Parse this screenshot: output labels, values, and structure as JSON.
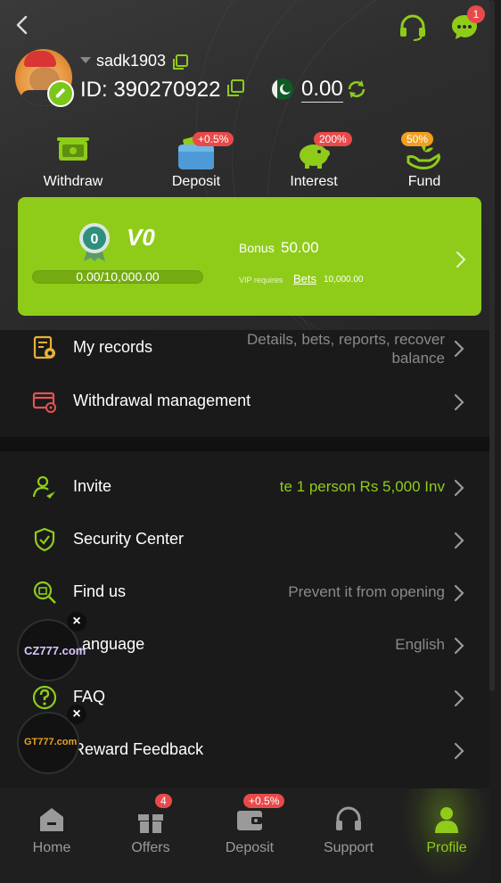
{
  "top_bar": {
    "back_icon": "chevron-left-icon",
    "support_icon": "headset-icon",
    "chat_icon": "chat-bubble-icon",
    "chat_badge": "1"
  },
  "profile": {
    "username": "sadk1903",
    "id_label": "ID: 390270922",
    "balance": "0.00",
    "currency_flag": "pakistan-flag-icon"
  },
  "quick_actions": [
    {
      "label": "Withdraw",
      "icon": "cash-icon",
      "tag": ""
    },
    {
      "label": "Deposit",
      "icon": "wallet-icon",
      "tag": "+0.5%"
    },
    {
      "label": "Interest",
      "icon": "piggy-bank-icon",
      "tag": "200%"
    },
    {
      "label": "Fund",
      "icon": "hand-plant-icon",
      "tag": "50%"
    }
  ],
  "vip": {
    "medal_level": "0",
    "level": "V0",
    "progress_text": "0.00/10,000.00",
    "progress_fraction": 0,
    "bonus_label": "Bonus",
    "bonus_value": "50.00",
    "requires_label": "VIP requires",
    "bets_link": "Bets",
    "requires_value": "10,000.00"
  },
  "menu_section_1": [
    {
      "label": "My records",
      "value": "Details, bets, reports, recover balance",
      "icon": "records-icon"
    },
    {
      "label": "Withdrawal management",
      "value": "",
      "icon": "withdrawal-card-icon"
    }
  ],
  "menu_section_2": [
    {
      "label": "Invite",
      "value": "te 1 person Rs 5,000  Inv",
      "icon": "invite-user-icon"
    },
    {
      "label": "Security Center",
      "value": "",
      "icon": "shield-icon"
    },
    {
      "label": "Find us",
      "value": "Prevent it from opening",
      "icon": "find-us-icon"
    },
    {
      "label": "Language",
      "value": "English",
      "icon": "language-icon"
    },
    {
      "label": "FAQ",
      "value": "",
      "icon": "question-icon"
    },
    {
      "label": "Reward Feedback",
      "value": "",
      "icon": "feedback-icon"
    }
  ],
  "floating_ads": [
    {
      "logo_text": "CZ777.com"
    },
    {
      "logo_text": "GT777.com"
    }
  ],
  "bottom_nav": [
    {
      "label": "Home",
      "icon": "home-icon",
      "badge": ""
    },
    {
      "label": "Offers",
      "icon": "gift-icon",
      "badge": "4"
    },
    {
      "label": "Deposit",
      "icon": "wallet-icon",
      "badge": "+0.5%"
    },
    {
      "label": "Support",
      "icon": "headset-icon",
      "badge": ""
    },
    {
      "label": "Profile",
      "icon": "user-icon",
      "badge": ""
    }
  ],
  "colors": {
    "accent": "#8fcc1a",
    "badge": "#e84a4a",
    "background": "#1a1a1a"
  }
}
